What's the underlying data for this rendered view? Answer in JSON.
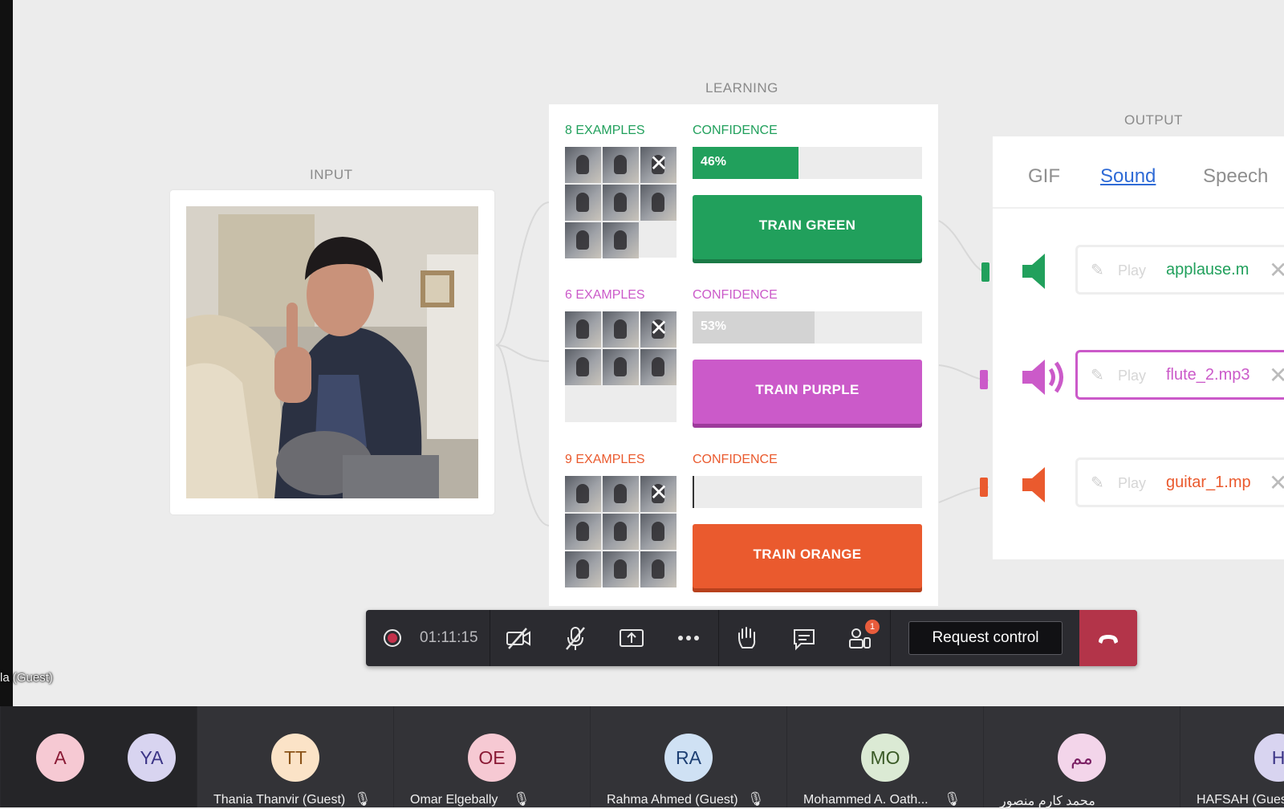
{
  "sections": {
    "input": "INPUT",
    "learning": "LEARNING",
    "output": "OUTPUT"
  },
  "classes": [
    {
      "examples": "8 EXAMPLES",
      "confidence_label": "CONFIDENCE",
      "confidence": "46%",
      "confidence_value": 0.46,
      "button": "TRAIN GREEN",
      "color": "#21a05c",
      "dark": "#1a7a46",
      "fill": "#21a05c"
    },
    {
      "examples": "6 EXAMPLES",
      "confidence_label": "CONFIDENCE",
      "confidence": "53%",
      "confidence_value": 0.53,
      "button": "TRAIN PURPLE",
      "color": "#cb5ac9",
      "dark": "#9d3a9b",
      "fill": "#d3d3d3"
    },
    {
      "examples": "9 EXAMPLES",
      "confidence_label": "CONFIDENCE",
      "confidence": "",
      "confidence_value": 0.0,
      "button": "TRAIN ORANGE",
      "color": "#ea5a2e",
      "dark": "#b8411d",
      "fill": "#333333"
    }
  ],
  "output": {
    "tabs": [
      "GIF",
      "Sound",
      "Speech"
    ],
    "active_tab": "Sound",
    "sounds": [
      {
        "play": "Play",
        "file": "applause.m",
        "color": "#21a05c"
      },
      {
        "play": "Play",
        "file": "flute_2.mp3",
        "color": "#cb5ac9"
      },
      {
        "play": "Play",
        "file": "guitar_1.mp",
        "color": "#ea5a2e"
      }
    ]
  },
  "meeting": {
    "timer": "01:11:15",
    "request_control": "Request control",
    "notification_count": "1",
    "guest_label": "la (Guest)"
  },
  "participants": [
    {
      "initials": "A",
      "name": "",
      "bg": "#f6c9d3",
      "fg": "#8a1a35"
    },
    {
      "initials": "YA",
      "name": "",
      "bg": "#d8d4f0",
      "fg": "#3b3486"
    },
    {
      "initials": "TT",
      "name": "Thania Thanvir (Guest)",
      "bg": "#fbe3c7",
      "fg": "#8a5217"
    },
    {
      "initials": "OE",
      "name": "Omar Elgebally",
      "bg": "#f6c9d3",
      "fg": "#8a1a35"
    },
    {
      "initials": "RA",
      "name": "Rahma Ahmed (Guest)",
      "bg": "#cfe1f4",
      "fg": "#1d3f73"
    },
    {
      "initials": "MO",
      "name": "Mohammed A. Oath...",
      "bg": "#dbead4",
      "fg": "#3a5a26"
    },
    {
      "initials": "مم",
      "name": "محمد كارم منصور",
      "bg": "#f3d5ea",
      "fg": "#7a1f63"
    },
    {
      "initials": "H",
      "name": "HAFSAH (Gues",
      "bg": "#d8d4f0",
      "fg": "#3b3486"
    }
  ]
}
